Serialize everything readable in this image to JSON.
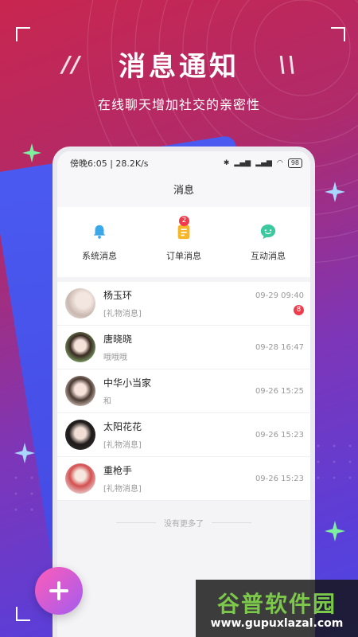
{
  "promo": {
    "headline": "消息通知",
    "subtitle": "在线聊天增加社交的亲密性"
  },
  "status_bar": {
    "time_speed": "傍晚6:05 | 28.2K/s",
    "battery": "98"
  },
  "nav": {
    "title": "消息"
  },
  "tabs": [
    {
      "label": "系统消息",
      "icon": "bell-icon",
      "color": "#3aa7e8"
    },
    {
      "label": "订单消息",
      "icon": "clipboard-icon",
      "color": "#f5b629",
      "badge": "2"
    },
    {
      "label": "互动消息",
      "icon": "chat-smile-icon",
      "color": "#3cc9a0"
    }
  ],
  "messages": [
    {
      "name": "杨玉环",
      "preview": "[礼物消息]",
      "time": "09-29 09:40",
      "unread": "8"
    },
    {
      "name": "唐晓晓",
      "preview": "哦哦哦",
      "time": "09-28 16:47"
    },
    {
      "name": "中华小当家",
      "preview": "和",
      "time": "09-26 15:25"
    },
    {
      "name": "太阳花花",
      "preview": "[礼物消息]",
      "time": "09-26 15:23"
    },
    {
      "name": "重枪手",
      "preview": "[礼物消息]",
      "time": "09-26 15:23"
    }
  ],
  "list_footer": "没有更多了",
  "watermark": {
    "title": "谷普软件园",
    "url": "www.gupuxlazal.com"
  },
  "colors": {
    "accent_red": "#ef3b4a",
    "bg_blue": "#4a5af0"
  }
}
